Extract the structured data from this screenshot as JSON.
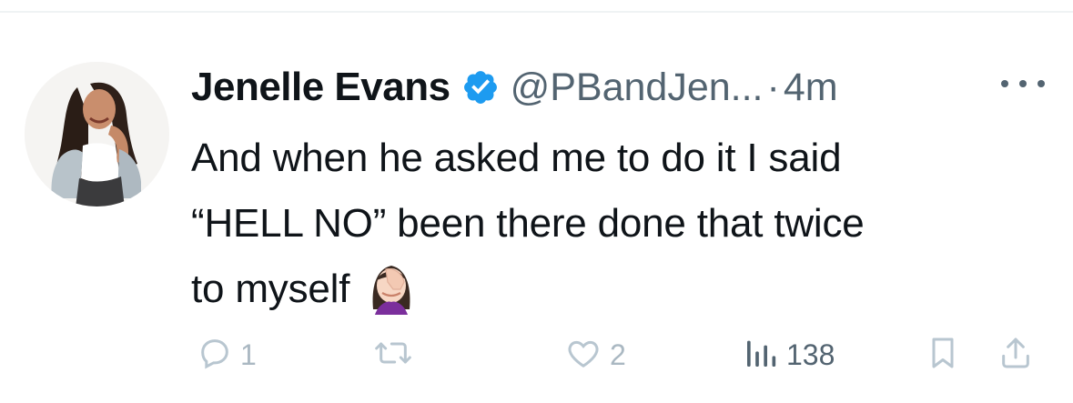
{
  "tweet": {
    "author_name": "Jenelle Evans",
    "handle": "@PBandJen...",
    "separator": "·",
    "time": "4m",
    "text_lines": [
      "And when he asked me to do it I said",
      "“HELL NO” been there done that twice",
      "to myself"
    ],
    "emoji": "woman-facepalming-icon"
  },
  "actions": {
    "reply_count": "1",
    "retweet_count": "",
    "like_count": "2",
    "view_count": "138"
  },
  "colors": {
    "text": "#0f1419",
    "secondary": "#536471",
    "verified": "#1d9bf0",
    "muted_icon": "#b8c6d0"
  }
}
